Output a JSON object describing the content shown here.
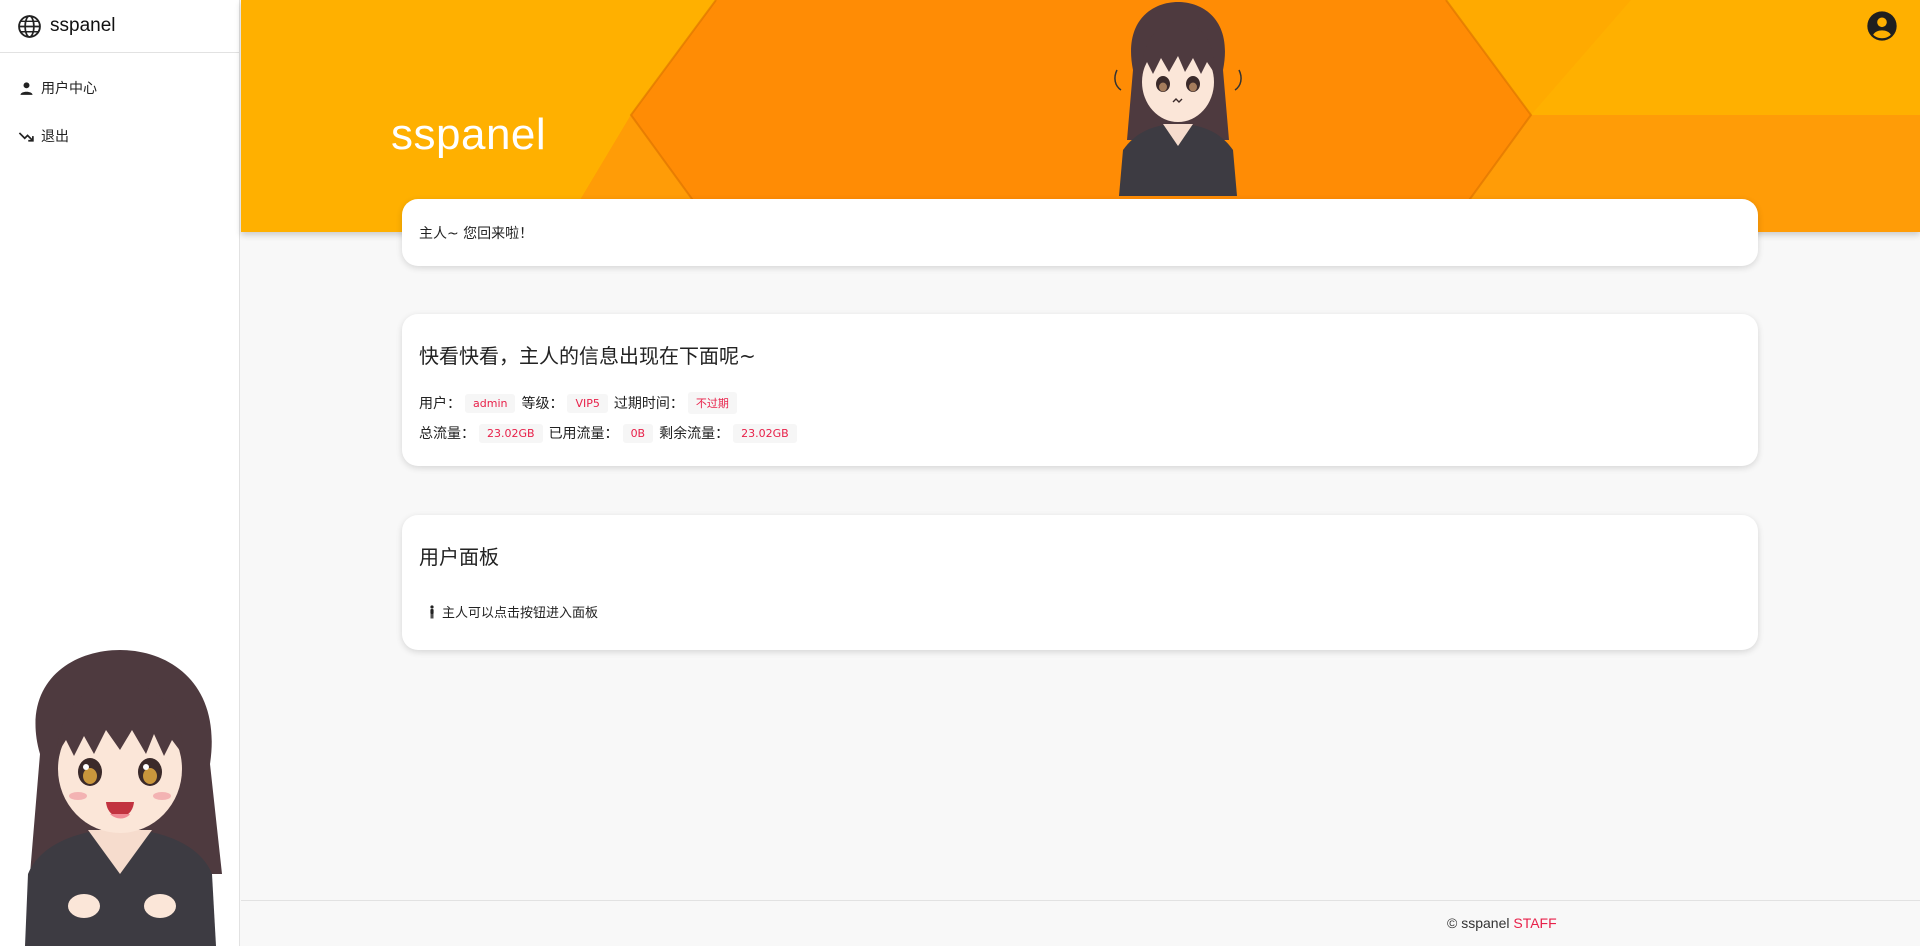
{
  "sidebar": {
    "brand": {
      "icon": "globe-icon",
      "title": "sspanel"
    },
    "items": [
      {
        "icon": "person-icon",
        "label": "用户中心"
      },
      {
        "icon": "trending-down-icon",
        "label": "退出"
      }
    ]
  },
  "header": {
    "title": "sspanel",
    "account_icon": "account-circle-icon",
    "colors": {
      "primary": "#ff8c05",
      "light": "#ffb000",
      "accent": "#e8214a"
    }
  },
  "welcome": {
    "text": "主人~ 您回来啦！"
  },
  "info": {
    "title": "快看快看，主人的信息出现在下面呢~",
    "user_label": "用户：",
    "user_value": "admin",
    "level_label": "等级：",
    "level_value": "VIP5",
    "expire_label": "过期时间：",
    "expire_value": "不过期",
    "total_label": "总流量：",
    "total_value": "23.02GB",
    "used_label": "已用流量：",
    "used_value": "0B",
    "remain_label": "剩余流量：",
    "remain_value": "23.02GB"
  },
  "panel": {
    "title": "用户面板",
    "hint": "主人可以点击按钮进入面板",
    "hint_icon": "man-icon"
  },
  "footer": {
    "copyright": "© sspanel ",
    "link": "STAFF"
  }
}
